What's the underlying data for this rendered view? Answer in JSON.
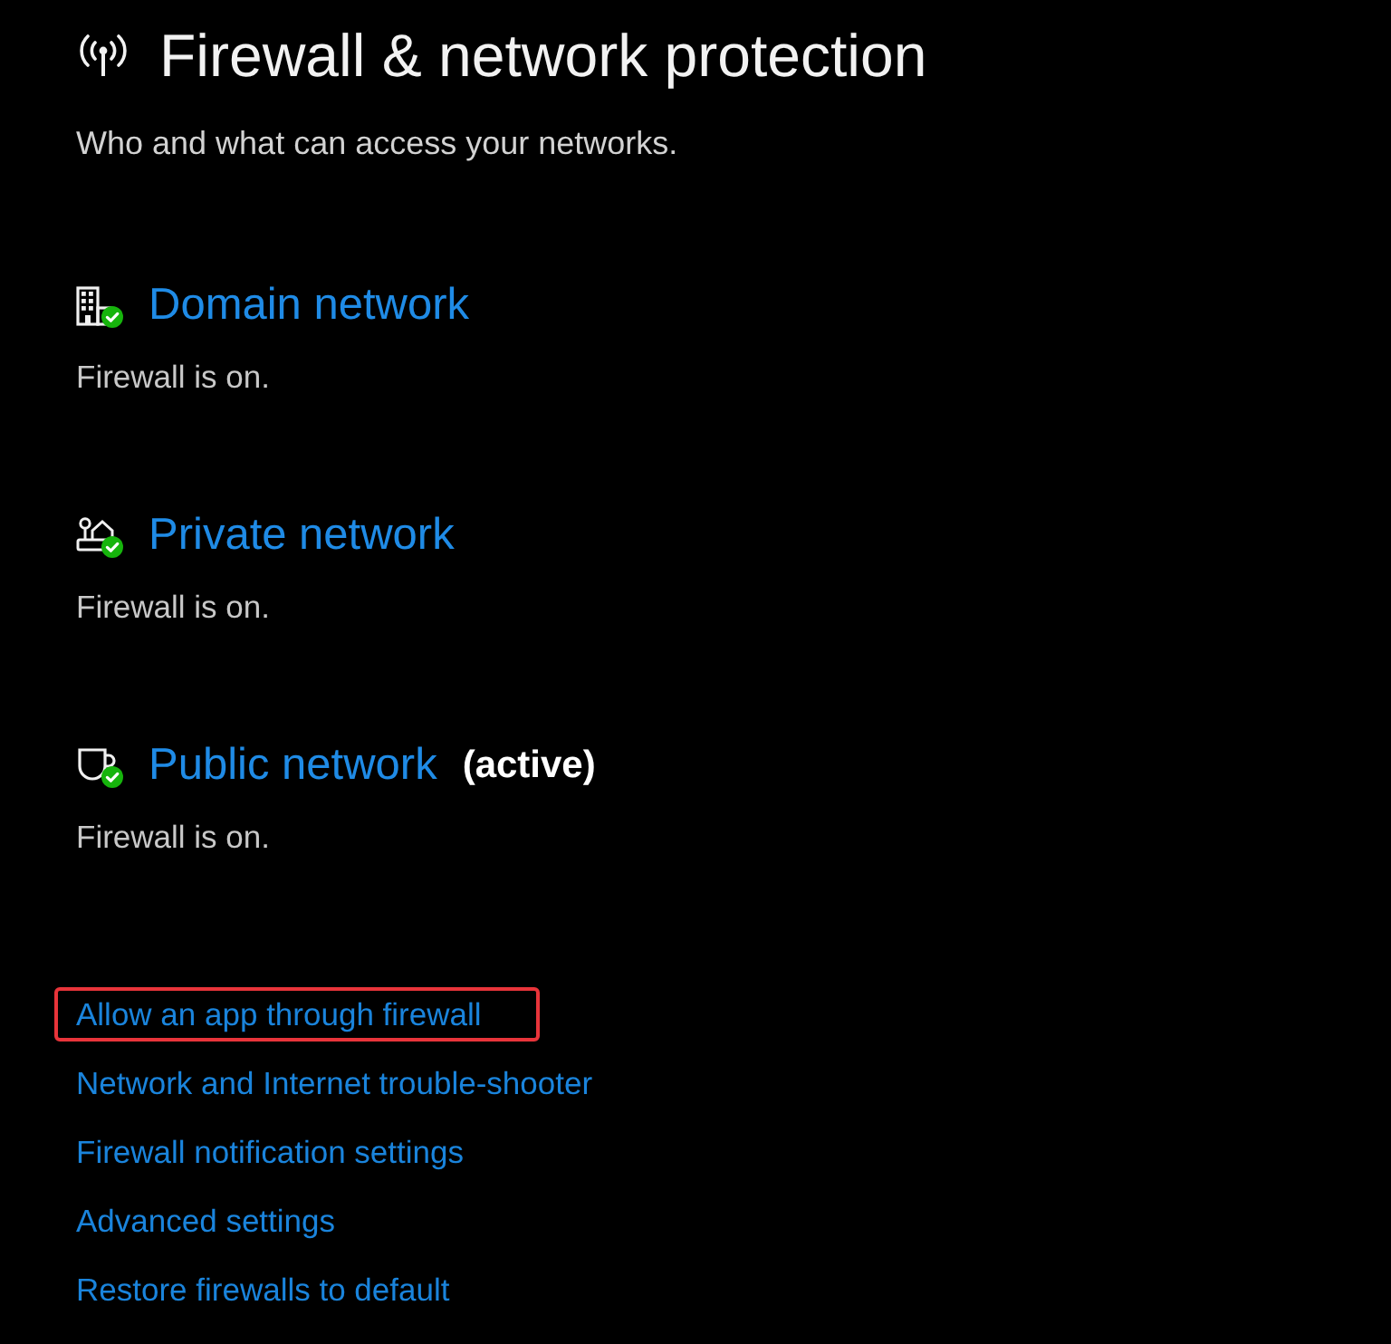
{
  "header": {
    "title": "Firewall & network protection",
    "subtitle": "Who and what can access your networks."
  },
  "networks": [
    {
      "kind": "domain",
      "name": "Domain network",
      "protected": true,
      "status": "Firewall is on."
    },
    {
      "kind": "private",
      "name": "Private network",
      "protected": true,
      "status": "Firewall is on."
    },
    {
      "kind": "public",
      "name": "Public network",
      "tag": "(active)",
      "protected": true,
      "status": "Firewall is on."
    }
  ],
  "links": [
    {
      "label": "Allow an app through firewall",
      "highlighted": true
    },
    {
      "label": "Network and Internet trouble-shooter",
      "highlighted": false
    },
    {
      "label": "Firewall notification settings",
      "highlighted": false
    },
    {
      "label": "Advanced settings",
      "highlighted": false
    },
    {
      "label": "Restore firewalls to default",
      "highlighted": false
    }
  ]
}
